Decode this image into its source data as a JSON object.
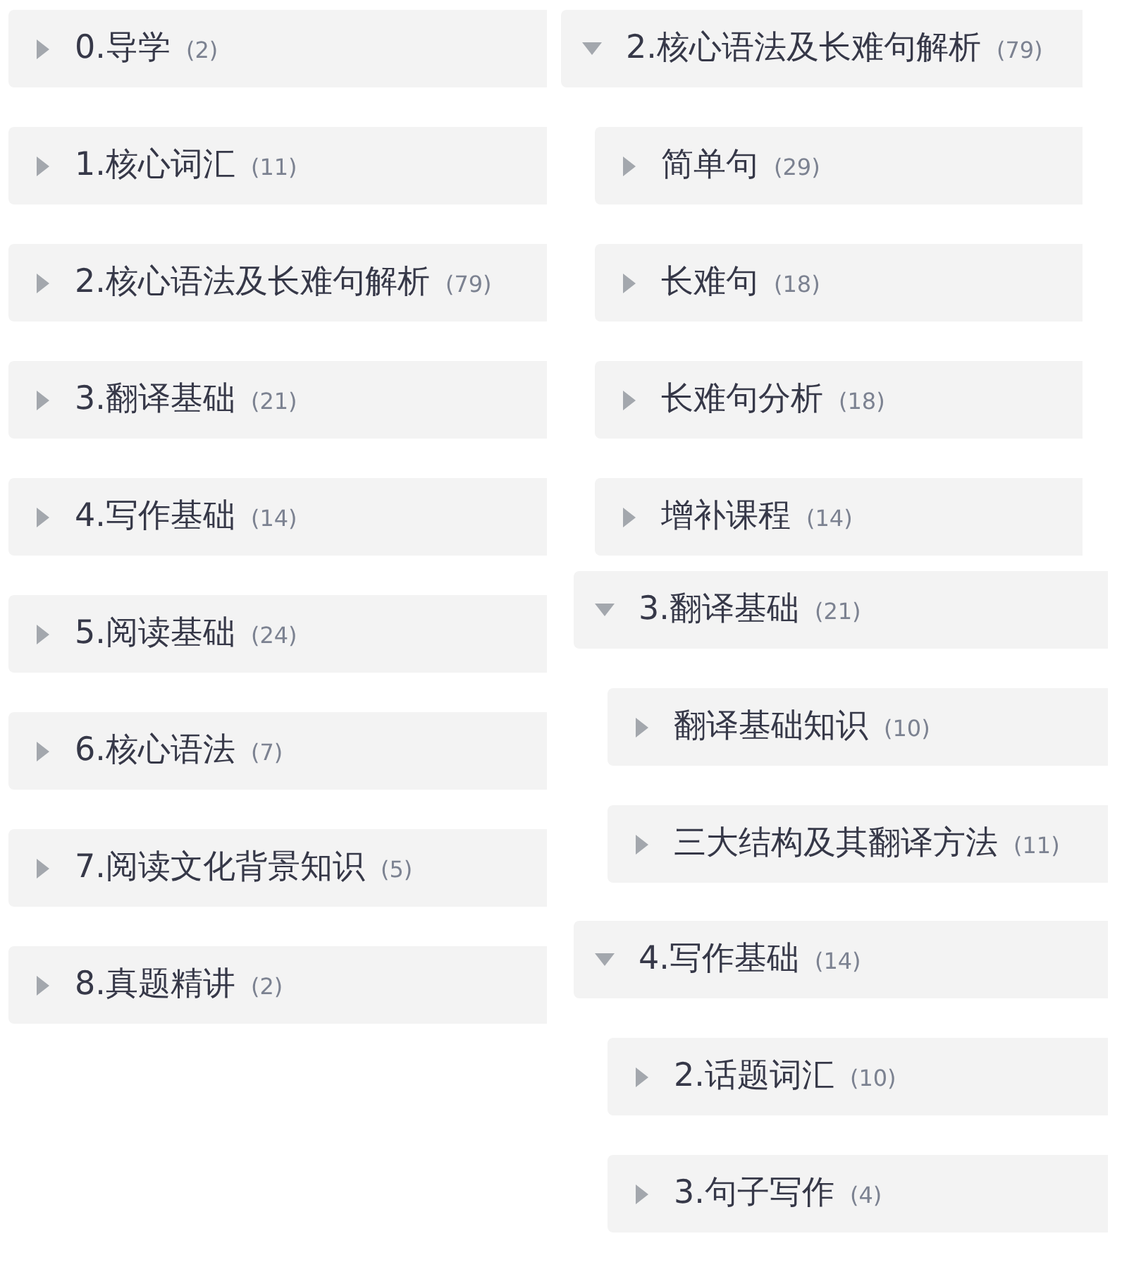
{
  "left_tree": {
    "items": [
      {
        "label": "0.导学",
        "count": "(2)",
        "expanded": false
      },
      {
        "label": "1.核心词汇",
        "count": "(11)",
        "expanded": false
      },
      {
        "label": "2.核心语法及长难句解析",
        "count": "(79)",
        "expanded": false
      },
      {
        "label": "3.翻译基础",
        "count": "(21)",
        "expanded": false
      },
      {
        "label": "4.写作基础",
        "count": "(14)",
        "expanded": false
      },
      {
        "label": "5.阅读基础",
        "count": "(24)",
        "expanded": false
      },
      {
        "label": "6.核心语法",
        "count": "(7)",
        "expanded": false
      },
      {
        "label": "7.阅读文化背景知识",
        "count": "(5)",
        "expanded": false
      },
      {
        "label": "8.真题精讲",
        "count": "(2)",
        "expanded": false
      }
    ]
  },
  "right_tree": {
    "groups": [
      {
        "label": "2.核心语法及长难句解析",
        "count": "(79)",
        "expanded": true,
        "children": [
          {
            "label": "简单句",
            "count": "(29)",
            "expanded": false
          },
          {
            "label": "长难句",
            "count": "(18)",
            "expanded": false
          },
          {
            "label": "长难句分析",
            "count": "(18)",
            "expanded": false
          },
          {
            "label": "增补课程",
            "count": "(14)",
            "expanded": false
          }
        ]
      },
      {
        "label": "3.翻译基础",
        "count": "(21)",
        "expanded": true,
        "children": [
          {
            "label": "翻译基础知识",
            "count": "(10)",
            "expanded": false
          },
          {
            "label": "三大结构及其翻译方法",
            "count": "(11)",
            "expanded": false
          }
        ]
      },
      {
        "label": "4.写作基础",
        "count": "(14)",
        "expanded": true,
        "children": [
          {
            "label": "2.话题词汇",
            "count": "(10)",
            "expanded": false
          },
          {
            "label": "3.句子写作",
            "count": "(4)",
            "expanded": false
          }
        ]
      }
    ]
  }
}
